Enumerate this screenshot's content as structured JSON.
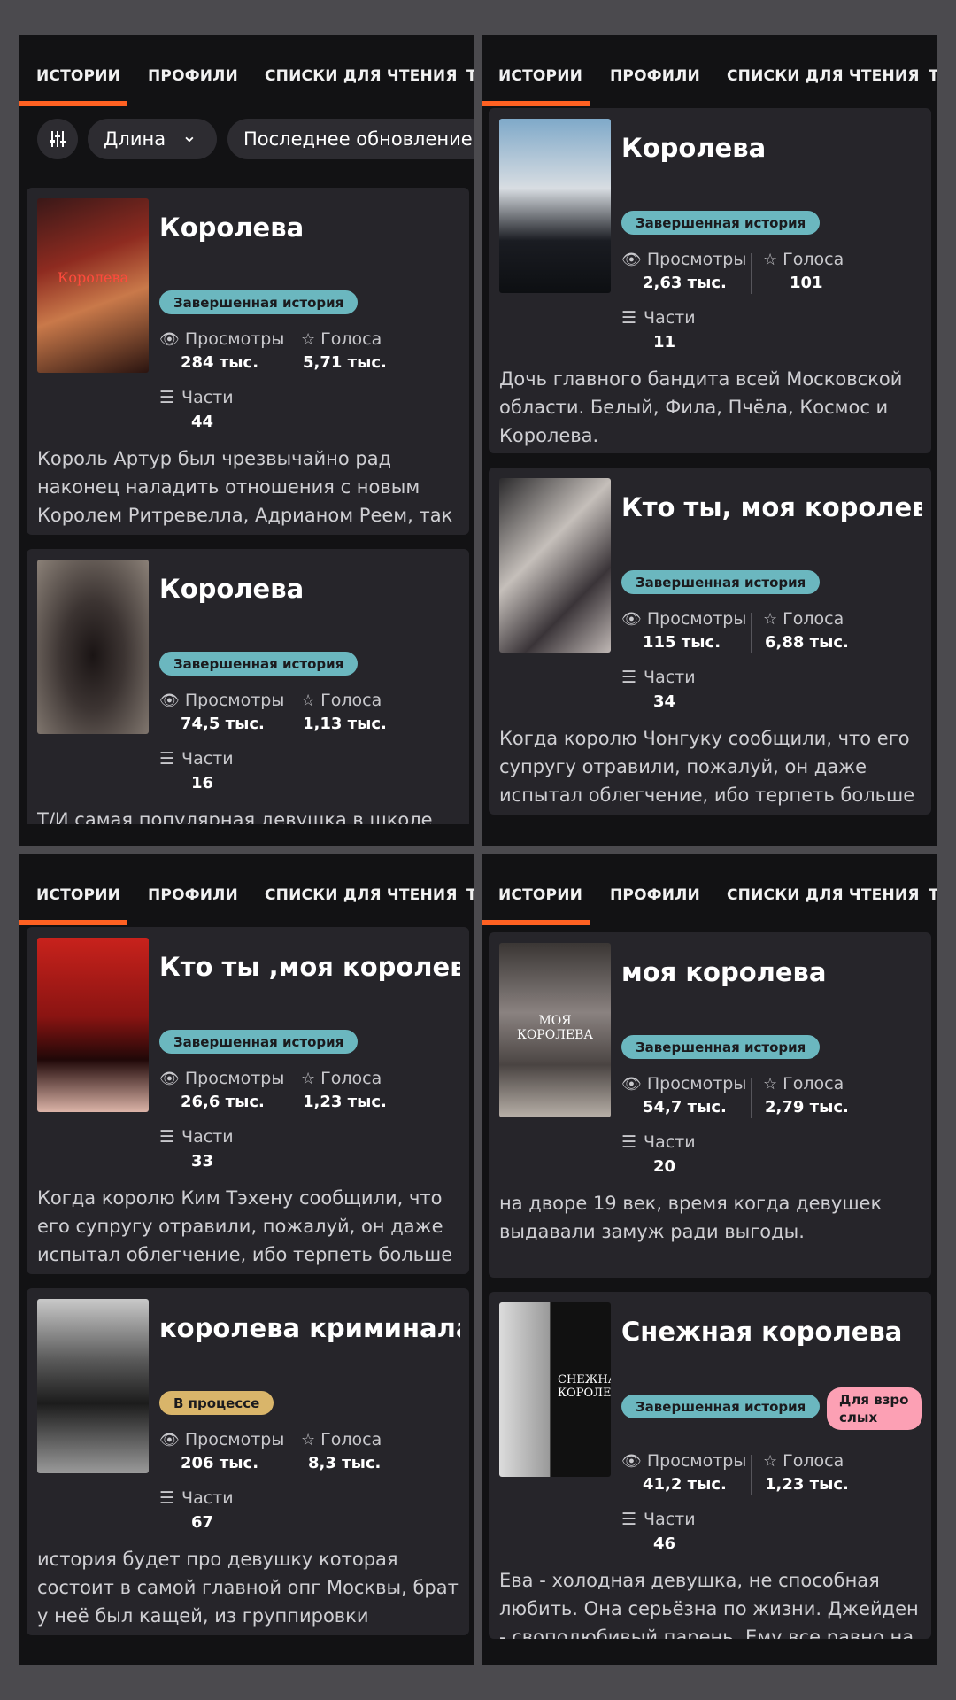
{
  "tabs": [
    "ИСТОРИИ",
    "ПРОФИЛИ",
    "СПИСКИ ДЛЯ ЧТЕНИЯ",
    "Т"
  ],
  "filters": {
    "length": "Длина",
    "chevron": "⌄",
    "sort": "Последнее обновление"
  },
  "labels": {
    "views": "Просмотры",
    "votes": "Голоса",
    "parts": "Части"
  },
  "accent_color": "#ff6122",
  "panels": [
    {
      "cards": [
        {
          "title": "Королева",
          "badge": "Завершенная история",
          "views": "284 тыс.",
          "votes": "5,71 тыс.",
          "parts": "44",
          "cover_text": "Королева",
          "description": "Король Артур был чрезвычайно рад наконец наладить отношения с новым Королем Ритревелла, Адрианом Реем, так как с его ум…"
        },
        {
          "title": "Королева",
          "badge": "Завершенная история",
          "views": "74,5 тыс.",
          "votes": "1,13 тыс.",
          "parts": "16",
          "description": "Т/И самая популярная девушка в школе Но"
        }
      ]
    },
    {
      "cards": [
        {
          "title": "Королева",
          "badge": "Завершенная история",
          "views": "2,63 тыс.",
          "votes": "101",
          "parts": "11",
          "description": "Дочь главного бандита всей Московской области. Белый, Фила, Пчёла, Космос и Королева."
        },
        {
          "title": "Кто ты, моя королева?",
          "badge": "Завершенная история",
          "views": "115 тыс.",
          "votes": "6,88 тыс.",
          "parts": "34",
          "description": "Когда королю Чонгуку сообщили, что его супругу отравили, пожалуй, он даже испытал облегчение, ибо терпеть больше не мог эту …"
        }
      ]
    },
    {
      "cards": [
        {
          "title": "Кто ты ,моя королева?",
          "badge": "Завершенная история",
          "views": "26,6 тыс.",
          "votes": "1,23 тыс.",
          "parts": "33",
          "description": "Когда королю Ким Тэхену сообщили, что его супругу отравили, пожалуй, он даже испытал облегчение, ибо терпеть больше н…"
        },
        {
          "title": "королева криминала",
          "badge": "В процессе",
          "views": "206 тыс.",
          "votes": "8,3 тыс.",
          "parts": "67",
          "description": "история будет про девушку которая состоит в самой главной опг Москвы, брат у неё был кащей, из группировки \"универсам\"…"
        }
      ]
    },
    {
      "cards": [
        {
          "title": "моя королева",
          "badge": "Завершенная история",
          "views": "54,7 тыс.",
          "votes": "2,79 тыс.",
          "parts": "20",
          "cover_text": "МОЯ КОРОЛЕВА",
          "description": "на дворе 19 век, время когда девушек выдавали замуж ради выгоды."
        },
        {
          "title": "Снежная королева",
          "badge": "Завершенная история",
          "badge_adult": "Для взро слых",
          "views": "41,2 тыс.",
          "votes": "1,23 тыс.",
          "parts": "46",
          "cover_text": "СНЕЖНАЯ КОРОЛЕВА",
          "description": "Ева - холодная девушка, не способная любить. Она серьёзна по жизни.  Джейден - своподюбивый парень. Ему все равно на о"
        }
      ]
    }
  ]
}
